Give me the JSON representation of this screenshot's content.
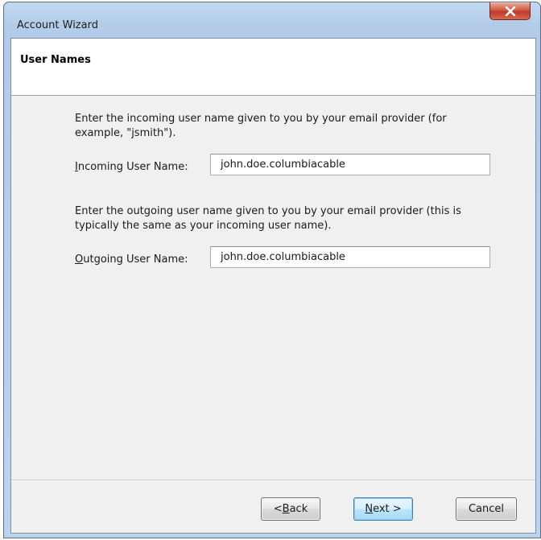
{
  "window": {
    "title": "Account Wizard"
  },
  "header": {
    "title": "User Names"
  },
  "incoming": {
    "description": "Enter the incoming user name given to you by your email provider (for example, \"jsmith\").",
    "label_accel": "I",
    "label_rest": "ncoming User Name:",
    "value": "john.doe.columbiacable"
  },
  "outgoing": {
    "description": "Enter the outgoing user name given to you by your email provider (this is typically the same as your incoming user name).",
    "label_accel": "O",
    "label_rest": "utgoing User Name:",
    "value": "john.doe.columbiacable"
  },
  "buttons": {
    "back_prefix": "< ",
    "back_accel": "B",
    "back_rest": "ack",
    "next_accel": "N",
    "next_rest": "ext >",
    "cancel": "Cancel"
  },
  "icons": {
    "close": "close-icon"
  },
  "colors": {
    "close_button": "#c0392b",
    "title_bar": "#b9d1ea",
    "client_bg": "#f0f0f0",
    "default_button_border": "#3c7fb1"
  }
}
